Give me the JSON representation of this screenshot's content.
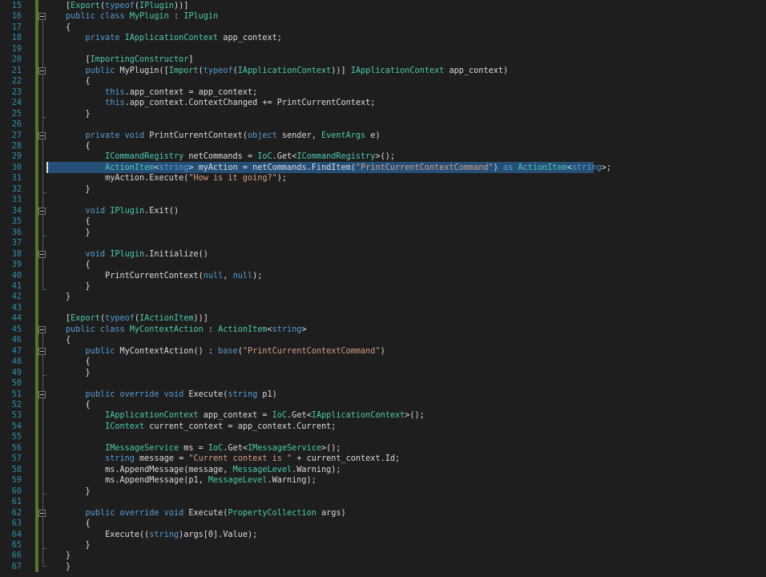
{
  "editor": {
    "lines": [
      {
        "num": "15",
        "tokens": [
          {
            "t": "["
          },
          {
            "t": "Export",
            "c": "attr"
          },
          {
            "t": "("
          },
          {
            "t": "typeof",
            "c": "kw"
          },
          {
            "t": "("
          },
          {
            "t": "IPlugin",
            "c": "ty"
          },
          {
            "t": "))]"
          }
        ]
      },
      {
        "num": "16",
        "tokens": [
          {
            "t": "public class ",
            "c": "kw"
          },
          {
            "t": "MyPlugin",
            "c": "ty"
          },
          {
            "t": " : "
          },
          {
            "t": "IPlugin",
            "c": "ty"
          }
        ]
      },
      {
        "num": "17",
        "tokens": [
          {
            "t": "{"
          }
        ]
      },
      {
        "num": "18",
        "tokens": [
          {
            "t": "    "
          },
          {
            "t": "private ",
            "c": "kw"
          },
          {
            "t": "IApplicationContext",
            "c": "ty"
          },
          {
            "t": " app_context;"
          }
        ]
      },
      {
        "num": "19",
        "tokens": []
      },
      {
        "num": "20",
        "tokens": [
          {
            "t": "    ["
          },
          {
            "t": "ImportingConstructor",
            "c": "attr"
          },
          {
            "t": "]"
          }
        ]
      },
      {
        "num": "21",
        "tokens": [
          {
            "t": "    "
          },
          {
            "t": "public ",
            "c": "kw"
          },
          {
            "t": "MyPlugin(["
          },
          {
            "t": "Import",
            "c": "attr"
          },
          {
            "t": "("
          },
          {
            "t": "typeof",
            "c": "kw"
          },
          {
            "t": "("
          },
          {
            "t": "IApplicationContext",
            "c": "ty"
          },
          {
            "t": "))] "
          },
          {
            "t": "IApplicationContext",
            "c": "ty"
          },
          {
            "t": " app_context)"
          }
        ]
      },
      {
        "num": "22",
        "tokens": [
          {
            "t": "    {"
          }
        ]
      },
      {
        "num": "23",
        "tokens": [
          {
            "t": "        "
          },
          {
            "t": "this",
            "c": "kw"
          },
          {
            "t": ".app_context = app_context;"
          }
        ]
      },
      {
        "num": "24",
        "tokens": [
          {
            "t": "        "
          },
          {
            "t": "this",
            "c": "kw"
          },
          {
            "t": ".app_context.ContextChanged += PrintCurrentContext;"
          }
        ]
      },
      {
        "num": "25",
        "tokens": [
          {
            "t": "    }"
          }
        ]
      },
      {
        "num": "26",
        "tokens": []
      },
      {
        "num": "27",
        "tokens": [
          {
            "t": "    "
          },
          {
            "t": "private void ",
            "c": "kw"
          },
          {
            "t": "PrintCurrentContext("
          },
          {
            "t": "object",
            "c": "kw"
          },
          {
            "t": " sender, "
          },
          {
            "t": "EventArgs",
            "c": "ty"
          },
          {
            "t": " e)"
          }
        ]
      },
      {
        "num": "28",
        "tokens": [
          {
            "t": "    {"
          }
        ]
      },
      {
        "num": "29",
        "tokens": [
          {
            "t": "        "
          },
          {
            "t": "ICommandRegistry",
            "c": "ty"
          },
          {
            "t": " netCommands = "
          },
          {
            "t": "IoC",
            "c": "ty"
          },
          {
            "t": ".Get<"
          },
          {
            "t": "ICommandRegistry",
            "c": "ty"
          },
          {
            "t": ">();"
          }
        ]
      },
      {
        "num": "30",
        "tokens": [
          {
            "t": "        "
          },
          {
            "t": "ActionItem",
            "c": "ty"
          },
          {
            "t": "<"
          },
          {
            "t": "string",
            "c": "kw"
          },
          {
            "t": "> myAction = netCommands.FindItem("
          },
          {
            "t": "\"PrintCurrentContextCommand\"",
            "c": "st"
          },
          {
            "t": ") "
          },
          {
            "t": "as ",
            "c": "kw"
          },
          {
            "t": "ActionItem",
            "c": "ty"
          },
          {
            "t": "<"
          },
          {
            "t": "string",
            "c": "kw"
          },
          {
            "t": ">;"
          }
        ]
      },
      {
        "num": "31",
        "tokens": [
          {
            "t": "        myAction.Execute("
          },
          {
            "t": "\"How is it going?\"",
            "c": "st"
          },
          {
            "t": ");"
          }
        ]
      },
      {
        "num": "32",
        "tokens": [
          {
            "t": "    }"
          }
        ]
      },
      {
        "num": "33",
        "tokens": []
      },
      {
        "num": "34",
        "tokens": [
          {
            "t": "    "
          },
          {
            "t": "void ",
            "c": "kw"
          },
          {
            "t": "IPlugin",
            "c": "ty"
          },
          {
            "t": ".Exit()"
          }
        ]
      },
      {
        "num": "35",
        "tokens": [
          {
            "t": "    {"
          }
        ]
      },
      {
        "num": "36",
        "tokens": [
          {
            "t": "    }"
          }
        ]
      },
      {
        "num": "37",
        "tokens": []
      },
      {
        "num": "38",
        "tokens": [
          {
            "t": "    "
          },
          {
            "t": "void ",
            "c": "kw"
          },
          {
            "t": "IPlugin",
            "c": "ty"
          },
          {
            "t": ".Initialize()"
          }
        ]
      },
      {
        "num": "39",
        "tokens": [
          {
            "t": "    {"
          }
        ]
      },
      {
        "num": "40",
        "tokens": [
          {
            "t": "        PrintCurrentContext("
          },
          {
            "t": "null",
            "c": "kw"
          },
          {
            "t": ", "
          },
          {
            "t": "null",
            "c": "kw"
          },
          {
            "t": ");"
          }
        ]
      },
      {
        "num": "41",
        "tokens": [
          {
            "t": "    }"
          }
        ]
      },
      {
        "num": "42",
        "tokens": [
          {
            "t": "}"
          }
        ]
      },
      {
        "num": "43",
        "tokens": []
      },
      {
        "num": "44",
        "tokens": [
          {
            "t": "["
          },
          {
            "t": "Export",
            "c": "attr"
          },
          {
            "t": "("
          },
          {
            "t": "typeof",
            "c": "kw"
          },
          {
            "t": "("
          },
          {
            "t": "IActionItem",
            "c": "ty"
          },
          {
            "t": "))]"
          }
        ]
      },
      {
        "num": "45",
        "tokens": [
          {
            "t": "public class ",
            "c": "kw"
          },
          {
            "t": "MyContextAction",
            "c": "ty"
          },
          {
            "t": " : "
          },
          {
            "t": "ActionItem",
            "c": "ty"
          },
          {
            "t": "<"
          },
          {
            "t": "string",
            "c": "kw"
          },
          {
            "t": ">"
          }
        ]
      },
      {
        "num": "46",
        "tokens": [
          {
            "t": "{"
          }
        ]
      },
      {
        "num": "47",
        "tokens": [
          {
            "t": "    "
          },
          {
            "t": "public ",
            "c": "kw"
          },
          {
            "t": "MyContextAction() : "
          },
          {
            "t": "base",
            "c": "kw"
          },
          {
            "t": "("
          },
          {
            "t": "\"PrintCurrentContextCommand\"",
            "c": "st"
          },
          {
            "t": ")"
          }
        ]
      },
      {
        "num": "48",
        "tokens": [
          {
            "t": "    {"
          }
        ]
      },
      {
        "num": "49",
        "tokens": [
          {
            "t": "    }"
          }
        ]
      },
      {
        "num": "50",
        "tokens": []
      },
      {
        "num": "51",
        "tokens": [
          {
            "t": "    "
          },
          {
            "t": "public override void ",
            "c": "kw"
          },
          {
            "t": "Execute("
          },
          {
            "t": "string",
            "c": "kw"
          },
          {
            "t": " p1)"
          }
        ]
      },
      {
        "num": "52",
        "tokens": [
          {
            "t": "    {"
          }
        ]
      },
      {
        "num": "53",
        "tokens": [
          {
            "t": "        "
          },
          {
            "t": "IApplicationContext",
            "c": "ty"
          },
          {
            "t": " app_context = "
          },
          {
            "t": "IoC",
            "c": "ty"
          },
          {
            "t": ".Get<"
          },
          {
            "t": "IApplicationContext",
            "c": "ty"
          },
          {
            "t": ">();"
          }
        ]
      },
      {
        "num": "54",
        "tokens": [
          {
            "t": "        "
          },
          {
            "t": "IContext",
            "c": "ty"
          },
          {
            "t": " current_context = app_context.Current;"
          }
        ]
      },
      {
        "num": "55",
        "tokens": []
      },
      {
        "num": "56",
        "tokens": [
          {
            "t": "        "
          },
          {
            "t": "IMessageService",
            "c": "ty"
          },
          {
            "t": " ms = "
          },
          {
            "t": "IoC",
            "c": "ty"
          },
          {
            "t": ".Get<"
          },
          {
            "t": "IMessageService",
            "c": "ty"
          },
          {
            "t": ">();"
          }
        ]
      },
      {
        "num": "57",
        "tokens": [
          {
            "t": "        "
          },
          {
            "t": "string",
            "c": "kw"
          },
          {
            "t": " message = "
          },
          {
            "t": "\"Current context is \"",
            "c": "st"
          },
          {
            "t": " + current_context.Id;"
          }
        ]
      },
      {
        "num": "58",
        "tokens": [
          {
            "t": "        ms.AppendMessage(message, "
          },
          {
            "t": "MessageLevel",
            "c": "ty"
          },
          {
            "t": ".Warning);"
          }
        ]
      },
      {
        "num": "59",
        "tokens": [
          {
            "t": "        ms.AppendMessage(p1, "
          },
          {
            "t": "MessageLevel",
            "c": "ty"
          },
          {
            "t": ".Warning);"
          }
        ]
      },
      {
        "num": "60",
        "tokens": [
          {
            "t": "    }"
          }
        ]
      },
      {
        "num": "61",
        "tokens": []
      },
      {
        "num": "62",
        "tokens": [
          {
            "t": "    "
          },
          {
            "t": "public override void ",
            "c": "kw"
          },
          {
            "t": "Execute("
          },
          {
            "t": "PropertyCollection",
            "c": "ty"
          },
          {
            "t": " args)"
          }
        ]
      },
      {
        "num": "63",
        "tokens": [
          {
            "t": "    {"
          }
        ]
      },
      {
        "num": "64",
        "tokens": [
          {
            "t": "        Execute(("
          },
          {
            "t": "string",
            "c": "kw"
          },
          {
            "t": ")args[0].Value);"
          }
        ]
      },
      {
        "num": "65",
        "tokens": [
          {
            "t": "    }"
          }
        ]
      },
      {
        "num": "66",
        "tokens": [
          {
            "t": "}"
          }
        ]
      },
      {
        "num": "67",
        "tokens": [
          {
            "t": "}"
          }
        ]
      }
    ],
    "selected_line": "30",
    "colors": {
      "background": "#1e1e1e",
      "keyword": "#569cd6",
      "type": "#4ec9b0",
      "string": "#d69d85",
      "plain": "#dcdcdc",
      "line_number": "#2b91af",
      "selection": "#264f78",
      "change_bar": "#577430"
    }
  }
}
